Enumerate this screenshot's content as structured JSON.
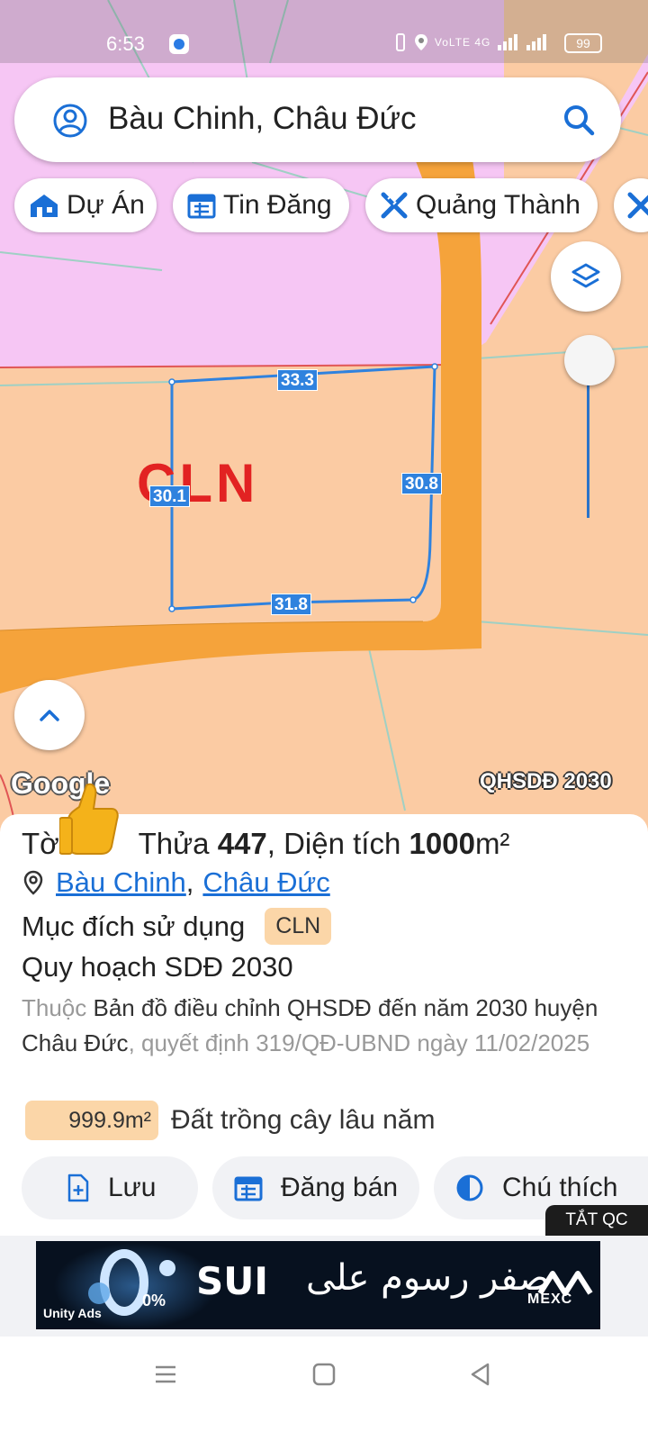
{
  "status_bar": {
    "time": "6:53",
    "network_text": "VoLTE 4G",
    "battery": "99"
  },
  "search": {
    "query": "Bàu Chinh, Châu Đức",
    "icons": [
      "user-circle-icon",
      "search-icon"
    ]
  },
  "chips": [
    {
      "label": "Dự Án",
      "icon": "house-icon"
    },
    {
      "label": "Tin Đăng",
      "icon": "calendar-icon"
    },
    {
      "label": "Quảng Thành",
      "icon": "ruler-pencil-icon"
    }
  ],
  "map": {
    "zone_label": "CLN",
    "measurements": {
      "top": "33.3",
      "right": "30.8",
      "left": "30.1",
      "bottom": "31.8"
    },
    "attribution": "Google",
    "layer_badge": "QHSDĐ 2030",
    "colors": {
      "residential": "#f6c6f4",
      "farmland": "#fbcba3",
      "road": "#f5a33b",
      "boundary": "#2f82de"
    }
  },
  "parcel": {
    "title_prefix": "Tờ",
    "title_thua": "Thửa",
    "title_number": "447",
    "title_area_label": ", Diện tích",
    "title_area_value": "1000",
    "title_area_unit": "m²",
    "location_link_1": "Bàu Chinh",
    "location_sep": ",",
    "location_link_2": "Châu Đức",
    "purpose_label": "Mục đích sử dụng",
    "purpose_tag": "CLN",
    "plan_label": "Quy hoạch SDĐ 2030",
    "desc_prefix": "Thuộc",
    "desc_map": "Bản đồ điều chỉnh QHSDĐ đến năm 2030 huyện Châu Đức",
    "desc_decision": ", quyết định 319/QĐ-UBND ngày 11/02/2025",
    "area_value": "999.9m²",
    "area_desc": "Đất trồng cây lâu năm"
  },
  "actions": [
    {
      "label": "Lưu",
      "icon": "file-plus-icon"
    },
    {
      "label": "Đăng bán",
      "icon": "calendar-icon"
    },
    {
      "label": "Chú thích",
      "icon": "half-circle-icon"
    }
  ],
  "ad": {
    "close_label": "TẮT QC",
    "headline": "SUI",
    "arabic_text": "صفر رسوم على",
    "brand": "MEXC",
    "network": "Unity Ads",
    "percent": "0%"
  }
}
